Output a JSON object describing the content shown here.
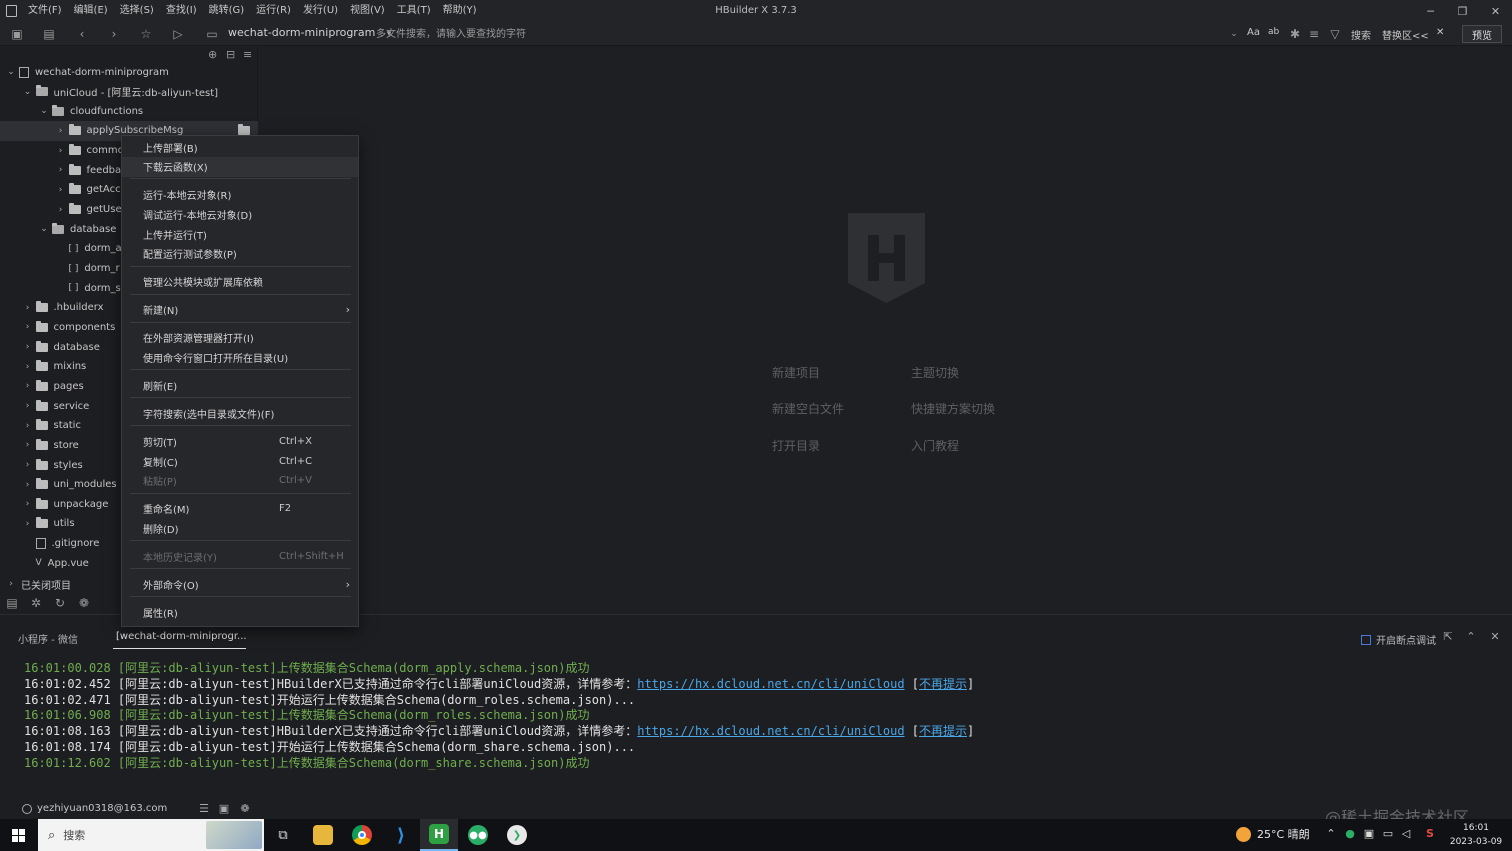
{
  "app": {
    "title": "HBuilder X 3.7.3",
    "menu": [
      "文件(F)",
      "编辑(E)",
      "选择(S)",
      "查找(I)",
      "跳转(G)",
      "运行(R)",
      "发行(U)",
      "视图(V)",
      "工具(T)",
      "帮助(Y)"
    ],
    "window_controls": {
      "minimize": "─",
      "restore": "❐",
      "close": "✕"
    }
  },
  "toolbar": {
    "project": "wechat-dorm-miniprogram",
    "dropdown_arrow": "▾",
    "search_placeholder": "多文件搜索，请输入要查找的字符",
    "right_items": {
      "aa": "Aa",
      "word": "ab",
      "search": "搜索",
      "replace": "替换区<<",
      "close": "✕"
    },
    "preview": "预览"
  },
  "sidebar": {
    "tree": [
      {
        "label": "wechat-dorm-miniprogram",
        "depth": 0,
        "type": "project",
        "expanded": true
      },
      {
        "label": "uniCloud - [阿里云:db-aliyun-test]",
        "depth": 1,
        "type": "folder",
        "expanded": true
      },
      {
        "label": "cloudfunctions",
        "depth": 2,
        "type": "folder",
        "expanded": true
      },
      {
        "label": "applySubscribeMsg",
        "depth": 3,
        "type": "folder",
        "expanded": false,
        "selected": true
      },
      {
        "label": "commo",
        "depth": 3,
        "type": "folder",
        "expanded": false
      },
      {
        "label": "feedbac",
        "depth": 3,
        "type": "folder",
        "expanded": false
      },
      {
        "label": "getAcce",
        "depth": 3,
        "type": "folder",
        "expanded": false
      },
      {
        "label": "getUser",
        "depth": 3,
        "type": "folder",
        "expanded": false
      },
      {
        "label": "database",
        "depth": 2,
        "type": "folder",
        "expanded": true
      },
      {
        "label": "dorm_a",
        "depth": 3,
        "type": "json"
      },
      {
        "label": "dorm_r",
        "depth": 3,
        "type": "json"
      },
      {
        "label": "dorm_s",
        "depth": 3,
        "type": "json"
      },
      {
        "label": ".hbuilderx",
        "depth": 1,
        "type": "folder",
        "expanded": false
      },
      {
        "label": "components",
        "depth": 1,
        "type": "folder",
        "expanded": false
      },
      {
        "label": "database",
        "depth": 1,
        "type": "folder",
        "expanded": false
      },
      {
        "label": "mixins",
        "depth": 1,
        "type": "folder",
        "expanded": false
      },
      {
        "label": "pages",
        "depth": 1,
        "type": "folder",
        "expanded": false
      },
      {
        "label": "service",
        "depth": 1,
        "type": "folder",
        "expanded": false
      },
      {
        "label": "static",
        "depth": 1,
        "type": "folder",
        "expanded": false
      },
      {
        "label": "store",
        "depth": 1,
        "type": "folder",
        "expanded": false
      },
      {
        "label": "styles",
        "depth": 1,
        "type": "folder",
        "expanded": false
      },
      {
        "label": "uni_modules",
        "depth": 1,
        "type": "folder",
        "expanded": false
      },
      {
        "label": "unpackage",
        "depth": 1,
        "type": "folder",
        "expanded": false
      },
      {
        "label": "utils",
        "depth": 1,
        "type": "folder",
        "expanded": false
      },
      {
        "label": ".gitignore",
        "depth": 1,
        "type": "file"
      },
      {
        "label": "App.vue",
        "depth": 1,
        "type": "vue"
      },
      {
        "label": "已关闭项目",
        "depth": 0,
        "type": "closed",
        "expanded": false
      }
    ]
  },
  "context_menu": {
    "items": [
      {
        "label": "上传部署(B)"
      },
      {
        "label": "下载云函数(X)",
        "hover": true
      },
      {
        "sep": true
      },
      {
        "label": "运行-本地云对象(R)"
      },
      {
        "label": "调试运行-本地云对象(D)"
      },
      {
        "label": "上传并运行(T)"
      },
      {
        "label": "配置运行测试参数(P)"
      },
      {
        "sep": true
      },
      {
        "label": "管理公共模块或扩展库依赖"
      },
      {
        "sep": true
      },
      {
        "label": "新建(N)",
        "submenu": true
      },
      {
        "sep": true
      },
      {
        "label": "在外部资源管理器打开(I)"
      },
      {
        "label": "使用命令行窗口打开所在目录(U)"
      },
      {
        "sep": true
      },
      {
        "label": "刷新(E)"
      },
      {
        "sep": true
      },
      {
        "label": "字符搜索(选中目录或文件)(F)"
      },
      {
        "sep": true
      },
      {
        "label": "剪切(T)",
        "shortcut": "Ctrl+X"
      },
      {
        "label": "复制(C)",
        "shortcut": "Ctrl+C"
      },
      {
        "label": "粘贴(P)",
        "shortcut": "Ctrl+V",
        "disabled": true
      },
      {
        "sep": true
      },
      {
        "label": "重命名(M)",
        "shortcut": "F2"
      },
      {
        "label": "删除(D)"
      },
      {
        "sep": true
      },
      {
        "label": "本地历史记录(Y)",
        "shortcut": "Ctrl+Shift+H",
        "disabled": true
      },
      {
        "sep": true
      },
      {
        "label": "外部命令(O)",
        "submenu": true
      },
      {
        "sep": true
      },
      {
        "label": "属性(R)"
      }
    ],
    "submenu_arrow": "›"
  },
  "welcome": {
    "new_project": "新建项目",
    "theme": "主题切换",
    "new_blank": "新建空白文件",
    "keymap": "快捷键方案切换",
    "open_dir": "打开目录",
    "tutorial": "入门教程"
  },
  "console": {
    "tab1": "小程序 - 微信",
    "tab2": "[wechat-dorm-miniprogr...",
    "breakpoint_label": "开启断点调试",
    "logs": [
      {
        "color": "green",
        "text": "16:01:00.028 [阿里云:db-aliyun-test]上传数据集合Schema(dorm_apply.schema.json)成功"
      },
      {
        "color": "white",
        "text": "16:01:02.452 [阿里云:db-aliyun-test]HBuilderX已支持通过命令行cli部署uniCloud资源，详情参考：",
        "link": "https://hx.dcloud.net.cn/cli/uniCloud",
        "suffix_open": " [",
        "suffix_link": "不再提示",
        "suffix_close": "]"
      },
      {
        "color": "white",
        "text": "16:01:02.471 [阿里云:db-aliyun-test]开始运行上传数据集合Schema(dorm_roles.schema.json)..."
      },
      {
        "color": "green",
        "text": "16:01:06.908 [阿里云:db-aliyun-test]上传数据集合Schema(dorm_roles.schema.json)成功"
      },
      {
        "color": "white",
        "text": "16:01:08.163 [阿里云:db-aliyun-test]HBuilderX已支持通过命令行cli部署uniCloud资源，详情参考：",
        "link": "https://hx.dcloud.net.cn/cli/uniCloud",
        "suffix_open": " [",
        "suffix_link": "不再提示",
        "suffix_close": "]"
      },
      {
        "color": "white",
        "text": "16:01:08.174 [阿里云:db-aliyun-test]开始运行上传数据集合Schema(dorm_share.schema.json)..."
      },
      {
        "color": "green",
        "text": "16:01:12.602 [阿里云:db-aliyun-test]上传数据集合Schema(dorm_share.schema.json)成功"
      }
    ]
  },
  "statusbar": {
    "user": "yezhiyuan0318@163.com",
    "watermark": "@稀土掘金技术社区"
  },
  "taskbar": {
    "search_placeholder": "搜索",
    "weather": "25°C 晴朗",
    "time": "16:01",
    "date": "2023-03-09",
    "ime": "S"
  },
  "colors": {
    "accent": "#4aa6e8",
    "log_green": "#6fae4f",
    "hbuilder_green": "#2ea043"
  }
}
